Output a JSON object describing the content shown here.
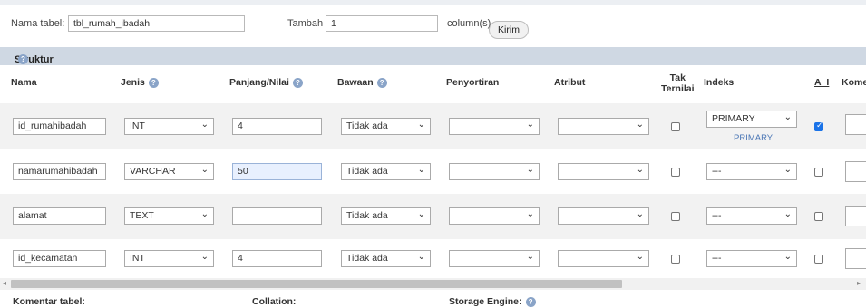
{
  "top": {
    "table_name_label": "Nama tabel:",
    "table_name_value": "tbl_rumah_ibadah",
    "add_label": "Tambah",
    "add_value": "1",
    "columns_label": "column(s)",
    "submit_label": "Kirim"
  },
  "section_title": "Struktur",
  "headers": {
    "name": "Nama",
    "type": "Jenis",
    "length": "Panjang/Nilai",
    "default": "Bawaan",
    "collation": "Penyortiran",
    "attribute": "Atribut",
    "null_line1": "Tak",
    "null_line2": "Ternilai",
    "index": "Indeks",
    "ai": "A_I",
    "comment": "Komen"
  },
  "rows": [
    {
      "name": "id_rumahibadah",
      "type": "INT",
      "length": "4",
      "default": "Tidak ada",
      "collation": "",
      "attribute": "",
      "null": false,
      "index": "PRIMARY",
      "index_note": "PRIMARY",
      "ai": true
    },
    {
      "name": "namarumahibadah",
      "type": "VARCHAR",
      "length": "50",
      "default": "Tidak ada",
      "collation": "",
      "attribute": "",
      "null": false,
      "index": "---",
      "index_note": "",
      "ai": false
    },
    {
      "name": "alamat",
      "type": "TEXT",
      "length": "",
      "default": "Tidak ada",
      "collation": "",
      "attribute": "",
      "null": false,
      "index": "---",
      "index_note": "",
      "ai": false
    },
    {
      "name": "id_kecamatan",
      "type": "INT",
      "length": "4",
      "default": "Tidak ada",
      "collation": "",
      "attribute": "",
      "null": false,
      "index": "---",
      "index_note": "",
      "ai": false
    }
  ],
  "footer": {
    "table_comment": "Komentar tabel:",
    "collation": "Collation:",
    "storage_engine": "Storage Engine:"
  },
  "colors": {
    "section_bg": "#cfd8e3",
    "row_alt_bg": "#f2f2f2",
    "accent_checkbox": "#1a73e8",
    "focused_input_bg": "#e8f0fe"
  },
  "icons": [
    "help-icon",
    "chevron-down-icon",
    "checkbox-icon",
    "scroll-left-icon",
    "scroll-right-icon"
  ]
}
